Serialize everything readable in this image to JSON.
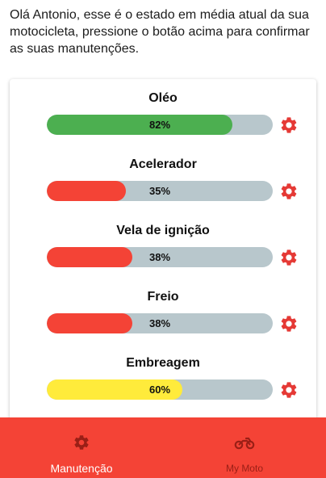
{
  "intro_text": "Olá Antonio, esse é o estado em média atual da sua motocicleta, pressione o botão acima para confirmar as suas manutenções.",
  "colors": {
    "green": "#4caf50",
    "red": "#f44336",
    "yellow": "#ffeb3b",
    "track": "#b8c7cc",
    "gear": "#e53935"
  },
  "items": [
    {
      "title": "Oléo",
      "percent_label": "82%",
      "value": 0.82,
      "color": "green"
    },
    {
      "title": "Acelerador",
      "percent_label": "35%",
      "value": 0.35,
      "color": "red"
    },
    {
      "title": "Vela de ignição",
      "percent_label": "38%",
      "value": 0.38,
      "color": "red"
    },
    {
      "title": "Freio",
      "percent_label": "38%",
      "value": 0.38,
      "color": "red"
    },
    {
      "title": "Embreagem",
      "percent_label": "60%",
      "value": 0.6,
      "color": "yellow"
    }
  ],
  "nav": {
    "manutencao_label": "Manutenção",
    "mymoto_label": "My Moto",
    "manutencao_icon": "gear-icon",
    "mymoto_icon": "motorcycle-icon"
  }
}
